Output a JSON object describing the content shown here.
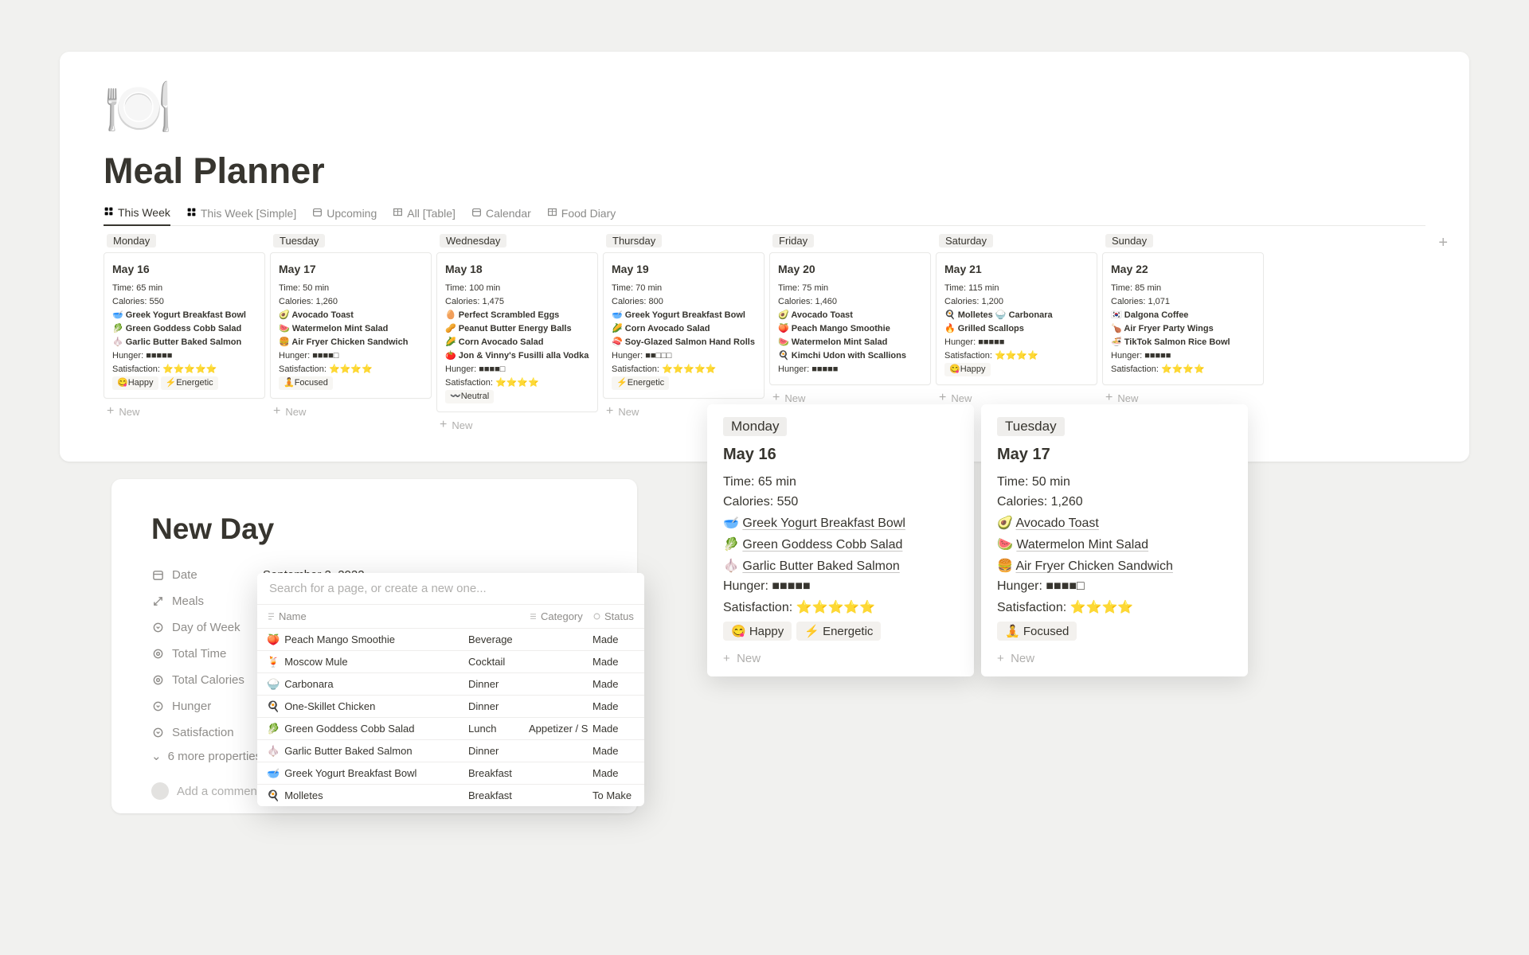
{
  "page": {
    "icon": "🍽️",
    "title": "Meal Planner"
  },
  "tabs": [
    {
      "label": "This Week",
      "active": true
    },
    {
      "label": "This Week [Simple]"
    },
    {
      "label": "Upcoming"
    },
    {
      "label": "All [Table]"
    },
    {
      "label": "Calendar"
    },
    {
      "label": "Food Diary"
    }
  ],
  "board_new_label": "New",
  "columns": [
    {
      "day": "Monday",
      "card": {
        "title": "May 16",
        "time": "Time: 65 min",
        "cals": "Calories: 550",
        "meals": [
          "🥣 Greek Yogurt Breakfast Bowl",
          "🥬 Green Goddess Cobb Salad",
          "🧄 Garlic Butter Baked Salmon"
        ],
        "hunger": "Hunger: ■■■■■",
        "sat": "Satisfaction: ⭐⭐⭐⭐⭐",
        "tags": [
          "😋Happy",
          "⚡Energetic"
        ]
      }
    },
    {
      "day": "Tuesday",
      "card": {
        "title": "May 17",
        "time": "Time: 50 min",
        "cals": "Calories: 1,260",
        "meals": [
          "🥑 Avocado Toast",
          "🍉 Watermelon Mint Salad",
          "🍔 Air Fryer Chicken Sandwich"
        ],
        "hunger": "Hunger: ■■■■□",
        "sat": "Satisfaction: ⭐⭐⭐⭐",
        "tags": [
          "🧘Focused"
        ]
      }
    },
    {
      "day": "Wednesday",
      "card": {
        "title": "May 18",
        "time": "Time: 100 min",
        "cals": "Calories: 1,475",
        "meals": [
          "🥚 Perfect Scrambled Eggs",
          "🥜 Peanut Butter Energy Balls",
          "🌽 Corn Avocado Salad",
          "🍅 Jon & Vinny's Fusilli alla Vodka"
        ],
        "hunger": "Hunger: ■■■■□",
        "sat": "Satisfaction: ⭐⭐⭐⭐",
        "tags": [
          "〰️Neutral"
        ]
      }
    },
    {
      "day": "Thursday",
      "card": {
        "title": "May 19",
        "time": "Time: 70 min",
        "cals": "Calories: 800",
        "meals": [
          "🥣 Greek Yogurt Breakfast Bowl",
          "🌽 Corn Avocado Salad",
          "🍣 Soy-Glazed Salmon Hand Rolls"
        ],
        "hunger": "Hunger: ■■□□□",
        "sat": "Satisfaction: ⭐⭐⭐⭐⭐",
        "tags": [
          "⚡Energetic"
        ]
      }
    },
    {
      "day": "Friday",
      "card": {
        "title": "May 20",
        "time": "Time: 75 min",
        "cals": "Calories: 1,460",
        "meals": [
          "🥑 Avocado Toast",
          "🍑 Peach Mango Smoothie",
          "🍉 Watermelon Mint Salad",
          "🍳 Kimchi Udon with Scallions"
        ],
        "hunger": "Hunger: ■■■■■",
        "tags": []
      }
    },
    {
      "day": "Saturday",
      "card": {
        "title": "May 21",
        "time": "Time: 115 min",
        "cals": "Calories: 1,200",
        "meals": [
          "🍳 Molletes  🍚 Carbonara",
          "🔥 Grilled Scallops"
        ],
        "hunger": "Hunger: ■■■■■",
        "sat": "Satisfaction: ⭐⭐⭐⭐",
        "tags": [
          "😋Happy"
        ]
      }
    },
    {
      "day": "Sunday",
      "card": {
        "title": "May 22",
        "time": "Time: 85 min",
        "cals": "Calories: 1,071",
        "meals": [
          "🇰🇷 Dalgona Coffee",
          "🍗 Air Fryer Party Wings",
          "🍜 TikTok Salmon Rice Bowl"
        ],
        "hunger": "Hunger: ■■■■■",
        "sat": "Satisfaction: ⭐⭐⭐⭐",
        "tags": []
      }
    }
  ],
  "overlay": [
    {
      "day": "Monday",
      "title": "May 16",
      "time": "Time: 65 min",
      "cals": "Calories: 550",
      "meals": [
        {
          "e": "🥣",
          "n": "Greek Yogurt Breakfast Bowl"
        },
        {
          "e": "🥬",
          "n": "Green Goddess Cobb Salad"
        },
        {
          "e": "🧄",
          "n": "Garlic Butter Baked Salmon"
        }
      ],
      "hunger": "Hunger: ■■■■■",
      "sat": "Satisfaction: ⭐⭐⭐⭐⭐",
      "tags": [
        "😋 Happy",
        "⚡ Energetic"
      ],
      "new": "New"
    },
    {
      "day": "Tuesday",
      "title": "May 17",
      "time": "Time: 50 min",
      "cals": "Calories: 1,260",
      "meals": [
        {
          "e": "🥑",
          "n": "Avocado Toast"
        },
        {
          "e": "🍉",
          "n": "Watermelon Mint Salad"
        },
        {
          "e": "🍔",
          "n": "Air Fryer Chicken Sandwich"
        }
      ],
      "hunger": "Hunger: ■■■■□",
      "sat": "Satisfaction: ⭐⭐⭐⭐",
      "tags": [
        "🧘 Focused"
      ],
      "new": "New"
    }
  ],
  "newday": {
    "title": "New Day",
    "props": [
      {
        "icon": "calendar",
        "label": "Date",
        "value": "September 2, 2022"
      },
      {
        "icon": "relation",
        "label": "Meals",
        "value": ""
      },
      {
        "icon": "select",
        "label": "Day of Week",
        "value": ""
      },
      {
        "icon": "rollup",
        "label": "Total Time",
        "value": ""
      },
      {
        "icon": "rollup",
        "label": "Total Calories",
        "value": ""
      },
      {
        "icon": "select",
        "label": "Hunger",
        "value": ""
      },
      {
        "icon": "select",
        "label": "Satisfaction",
        "value": ""
      }
    ],
    "more": "6 more properties",
    "comment": "Add a comment..."
  },
  "search": {
    "placeholder": "Search for a page, or create a new one...",
    "headers": {
      "name": "Name",
      "category": "Category",
      "status": "Status"
    },
    "rows": [
      {
        "e": "🍑",
        "name": "Peach Mango Smoothie",
        "cat": "Beverage",
        "status": "Made"
      },
      {
        "e": "🍹",
        "name": "Moscow Mule",
        "cat": "Cocktail",
        "status": "Made"
      },
      {
        "e": "🍚",
        "name": "Carbonara",
        "cat": "Dinner",
        "status": "Made"
      },
      {
        "e": "🍳",
        "name": "One-Skillet Chicken",
        "cat": "Dinner",
        "status": "Made"
      },
      {
        "e": "🥬",
        "name": "Green Goddess Cobb Salad",
        "cat": "Lunch",
        "cat2": "Appetizer / S",
        "status": "Made"
      },
      {
        "e": "🧄",
        "name": "Garlic Butter Baked Salmon",
        "cat": "Dinner",
        "status": "Made"
      },
      {
        "e": "🥣",
        "name": "Greek Yogurt Breakfast Bowl",
        "cat": "Breakfast",
        "status": "Made"
      },
      {
        "e": "🍳",
        "name": "Molletes",
        "cat": "Breakfast",
        "status": "To Make"
      }
    ]
  }
}
